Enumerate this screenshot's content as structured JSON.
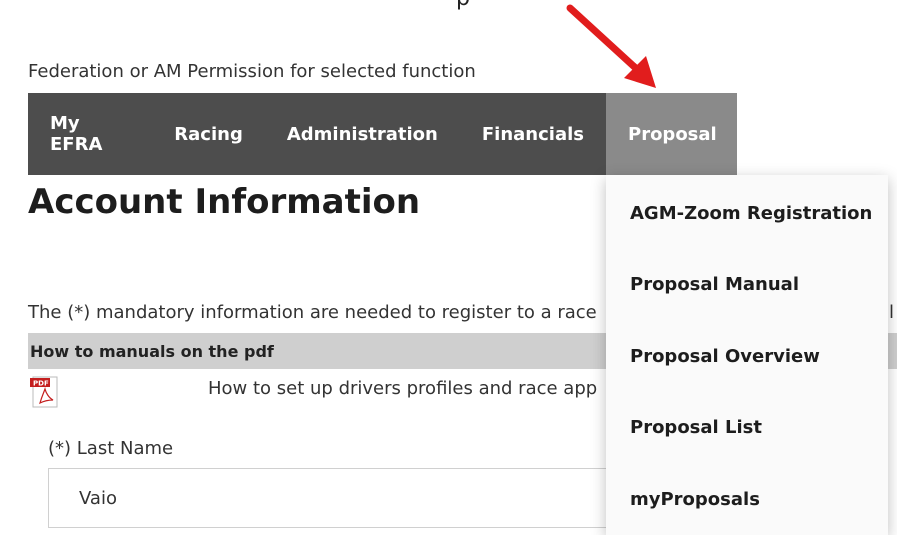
{
  "top_text": "p",
  "permission_text": "Federation or AM Permission for selected function",
  "nav": {
    "items": [
      "My EFRA",
      "Racing",
      "Administration",
      "Financials"
    ],
    "active": "Proposal"
  },
  "dropdown": {
    "items": [
      "AGM-Zoom Registration",
      "Proposal Manual",
      "Proposal Overview",
      "Proposal List",
      "myProposals"
    ]
  },
  "page": {
    "title": "Account Information",
    "mandatory_text": "The (*) mandatory information are needed to register to a race",
    "mandatory_tail": "ll",
    "howto_title": "How to manuals on the pdf",
    "pdf_link_text": "How to set up drivers profiles and race app"
  },
  "form": {
    "last_name_label": "(*) Last Name",
    "last_name_value": "Vaio"
  },
  "colors": {
    "navbar_bg": "#4d4d4d",
    "active_tab_bg": "#8a8a8a",
    "arrow": "#e11d1d",
    "pdf_icon": "#c41e1e"
  }
}
